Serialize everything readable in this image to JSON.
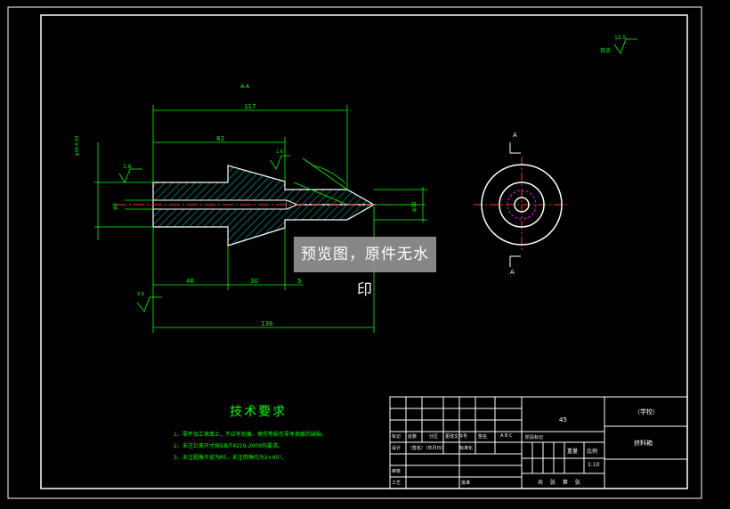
{
  "drawing": {
    "section_label": "A-A",
    "view_label_top": "A",
    "view_label_bottom": "A",
    "roughness_general": "12.5",
    "roughness_general_prefix": "其余",
    "roughness_values": [
      "1.6",
      "1.6",
      "1.6"
    ],
    "dimensions": {
      "total_length_top": "117",
      "length_82": "82",
      "length_46": "46",
      "length_30": "30",
      "length_5": "5",
      "total_length_bottom": "136",
      "dia_left": "φ30-0.03",
      "dia_bore": "φ9",
      "dia_right": "φ30"
    }
  },
  "watermark": "预览图，原件无水印",
  "tech_requirements": {
    "title": "技术要求",
    "items": [
      "1、零件加工表面上，不应有划痕、擦伤等损伤零件表面的缺陷。",
      "2、未注公差尺寸按GB/T4219-2009的要求。",
      "3、未注圆角半径为R5，未注倒角均为2×45°。"
    ]
  },
  "title_block": {
    "material": "45",
    "school": "（学校）",
    "part_name": "挤料箱",
    "scale": "1:10",
    "weight_label": "重量",
    "scale_label": "比例",
    "sheet_text": "共 张 第 张",
    "rows": [
      "标记",
      "处数",
      "分区",
      "更改文件号",
      "签名",
      "年月日"
    ],
    "design_label": "设计",
    "std_label": "标准化",
    "review_label": "审核",
    "process_label": "工艺",
    "approve_label": "批准",
    "stage_label": "阶段标记",
    "date_sign": "（签名）（年月日）",
    "abc": "A  B  C"
  }
}
